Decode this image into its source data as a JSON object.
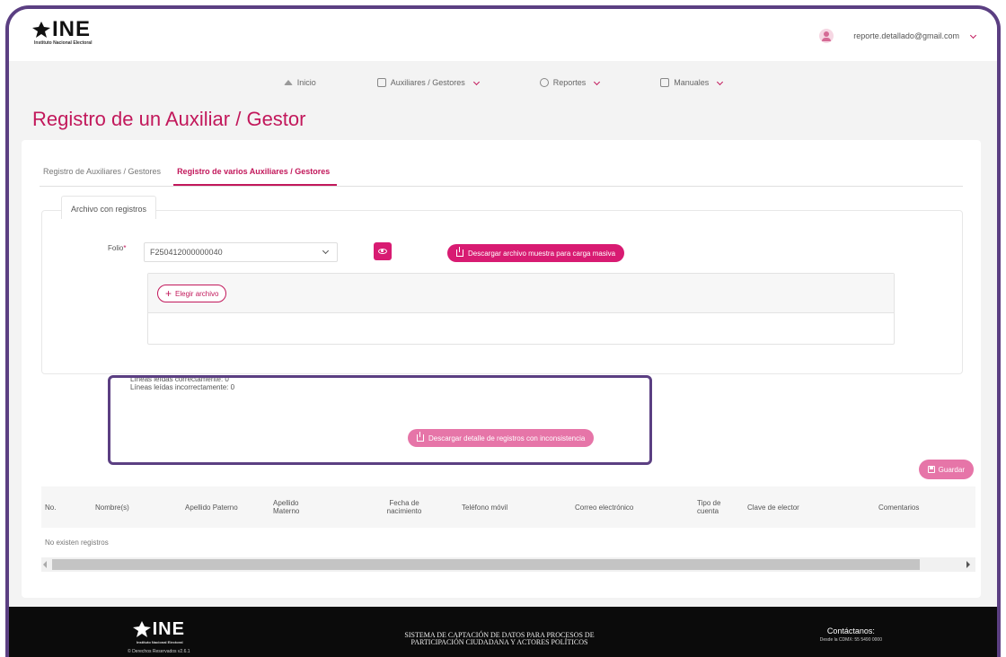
{
  "header": {
    "logo_text": "INE",
    "logo_subtitle": "Instituto Nacional Electoral",
    "user_email": "reporte.detallado@gmail.com"
  },
  "nav": {
    "items": [
      {
        "label": "Inicio",
        "icon": "home-icon"
      },
      {
        "label": "Auxiliares / Gestores",
        "icon": "file-icon"
      },
      {
        "label": "Reportes",
        "icon": "chart-icon"
      },
      {
        "label": "Manuales",
        "icon": "book-icon"
      }
    ]
  },
  "page": {
    "title": "Registro de un Auxiliar / Gestor"
  },
  "tabs": [
    {
      "label": "Registro de Auxiliares / Gestores",
      "active": false
    },
    {
      "label": "Registro de varios Auxiliares / Gestores",
      "active": true
    }
  ],
  "form": {
    "legend": "Archivo con registros",
    "folio_label": "Folio",
    "required_mark": "*",
    "folio_value": "F250412000000040",
    "download_sample_label": "Descargar archivo muestra para carga masiva",
    "choose_file_label": "Elegir archivo"
  },
  "summary": {
    "correct_lines": "Líneas leídas correctamente: 0",
    "incorrect_lines": "Líneas leídas incorrectamente: 0",
    "download_detail_label": "Descargar detalle de registros con inconsistencia"
  },
  "actions": {
    "save_label": "Guardar"
  },
  "table": {
    "headers": [
      "No.",
      "Nombre(s)",
      "Apellido Paterno",
      "Apellido Materno",
      "Fecha de nacimiento",
      "Teléfono móvil",
      "Correo electrónico",
      "Tipo de cuenta",
      "Clave de elector",
      "Comentarios"
    ],
    "empty_message": "No existen registros"
  },
  "footer": {
    "logo_text": "INE",
    "logo_subtitle": "Instituto Nacional Electoral",
    "rights": "© Derechos Reservados v2.6.1",
    "system_line1": "SISTEMA DE CAPTACIÓN DE DATOS PARA PROCESOS DE",
    "system_line2": "PARTICIPACIÓN CIUDADANA Y ACTORES POLÍTICOS",
    "contact_title": "Contáctanos:",
    "contact_phone": "Desde la CDMX: 55 5490 0000"
  },
  "colors": {
    "accent": "#c2185b",
    "button": "#d81b72",
    "frame": "#5b3f82",
    "footer": "#0b0b0b"
  }
}
